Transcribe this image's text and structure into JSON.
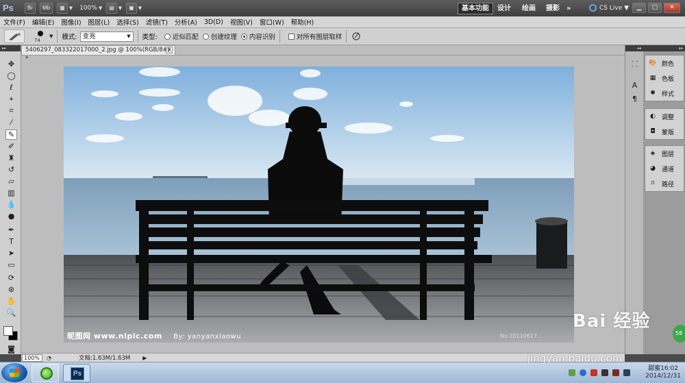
{
  "appbar": {
    "logo": "Ps",
    "bridge_label": "Br",
    "minibridge_label": "Mb",
    "zoom": "100%",
    "workspaces": [
      "基本功能",
      "设计",
      "绘画",
      "摄影"
    ],
    "more": "»",
    "cslive": "CS Live"
  },
  "menu": [
    "文件(F)",
    "编辑(E)",
    "图像(I)",
    "图层(L)",
    "选择(S)",
    "滤镜(T)",
    "分析(A)",
    "3D(D)",
    "视图(V)",
    "窗口(W)",
    "帮助(H)"
  ],
  "options": {
    "brush_size": "74",
    "mode_label": "模式:",
    "mode_value": "变亮",
    "type_label": "类型:",
    "type_options": [
      {
        "label": "近似匹配",
        "selected": false
      },
      {
        "label": "创建纹理",
        "selected": false
      },
      {
        "label": "内容识别",
        "selected": true
      }
    ],
    "sample_all_label": "对所有图层取样"
  },
  "document": {
    "tab_title": "5406297_083322017000_2.jpg @ 100%(RGB/8#) *",
    "watermark": "昵图网 www.nipic.com",
    "watermark_by": "By: yanyanxiaowu",
    "watermark_id": "No.20110617..."
  },
  "status": {
    "zoom": "100%",
    "doc_info": "文档:1.63M/1.63M"
  },
  "panels": {
    "group1": [
      "颜色",
      "色板",
      "样式"
    ],
    "group2": [
      "调整",
      "蒙版"
    ],
    "group3": [
      "图层",
      "通道",
      "路径"
    ]
  },
  "taskbar": {
    "ps_label": "Ps",
    "time": "甜蜜16:02",
    "date": "2014/12/31"
  },
  "overlay": {
    "baidu": "Bai   经验",
    "baidu_url": "jingyan.baidu.com",
    "badge": "58"
  },
  "colors": {
    "accent": "#3d3d3d",
    "sky": "#9fc3e5",
    "taskbar": "#b4c9e0"
  }
}
